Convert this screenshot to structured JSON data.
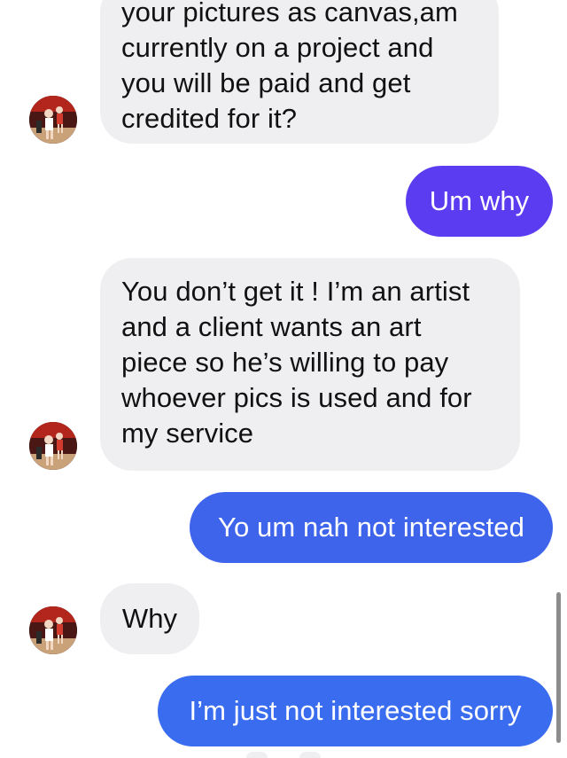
{
  "chat": {
    "messages": [
      {
        "side": "incoming",
        "text": "your pictures as canvas,am\ncurrently on a project and\nyou will be paid and get\ncredited for it?"
      },
      {
        "side": "outgoing",
        "text": "Um why"
      },
      {
        "side": "incoming",
        "text": "You don’t get it ! I’m an artist\nand a client wants an art\npiece so he’s willing to pay\nwhoever pics is used and for\nmy service"
      },
      {
        "side": "outgoing",
        "text": "Yo um nah not interested"
      },
      {
        "side": "incoming",
        "text": "Why"
      },
      {
        "side": "outgoing",
        "text": "I’m just not interested sorry"
      }
    ],
    "avatar_icon": "contact-avatar-photo"
  },
  "colors": {
    "incoming_bubble": "#efeff1",
    "outgoing_bubble_purple": "#5b3cf0",
    "outgoing_bubble_blue": "#3f64ec",
    "outgoing_bubble_last": "#3a6cf0",
    "text_dark": "#111111",
    "text_light": "#ffffff"
  }
}
